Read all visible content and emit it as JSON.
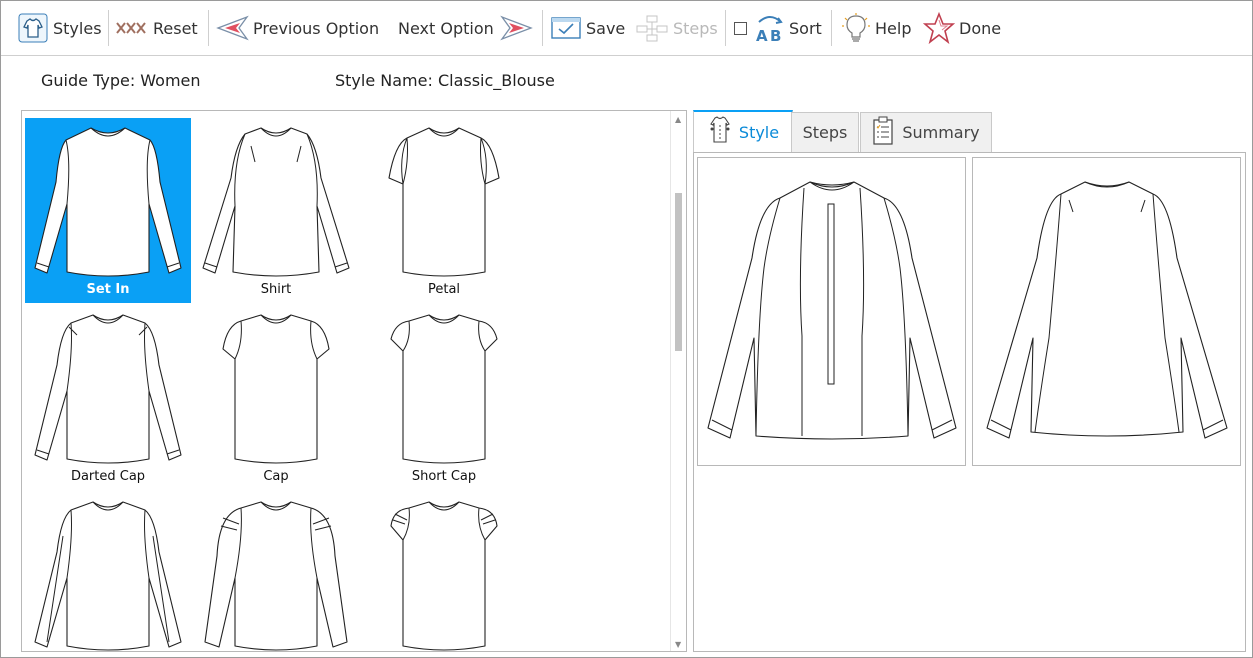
{
  "toolbar": {
    "styles": "Styles",
    "reset": "Reset",
    "previous": "Previous Option",
    "next": "Next Option",
    "save": "Save",
    "steps": "Steps",
    "sort": "Sort",
    "help": "Help",
    "done": "Done"
  },
  "info": {
    "guide_type": "Guide Type: Women",
    "style_name": "Style Name: Classic_Blouse"
  },
  "options": [
    {
      "label": "Set In",
      "selected": true
    },
    {
      "label": "Shirt"
    },
    {
      "label": "Petal"
    },
    {
      "label": "Darted Cap"
    },
    {
      "label": "Cap"
    },
    {
      "label": "Short Cap"
    },
    {
      "label": ""
    },
    {
      "label": ""
    },
    {
      "label": ""
    }
  ],
  "tabs": {
    "style": "Style",
    "steps": "Steps",
    "summary": "Summary"
  },
  "colors": {
    "accent": "#0aa0f5"
  }
}
